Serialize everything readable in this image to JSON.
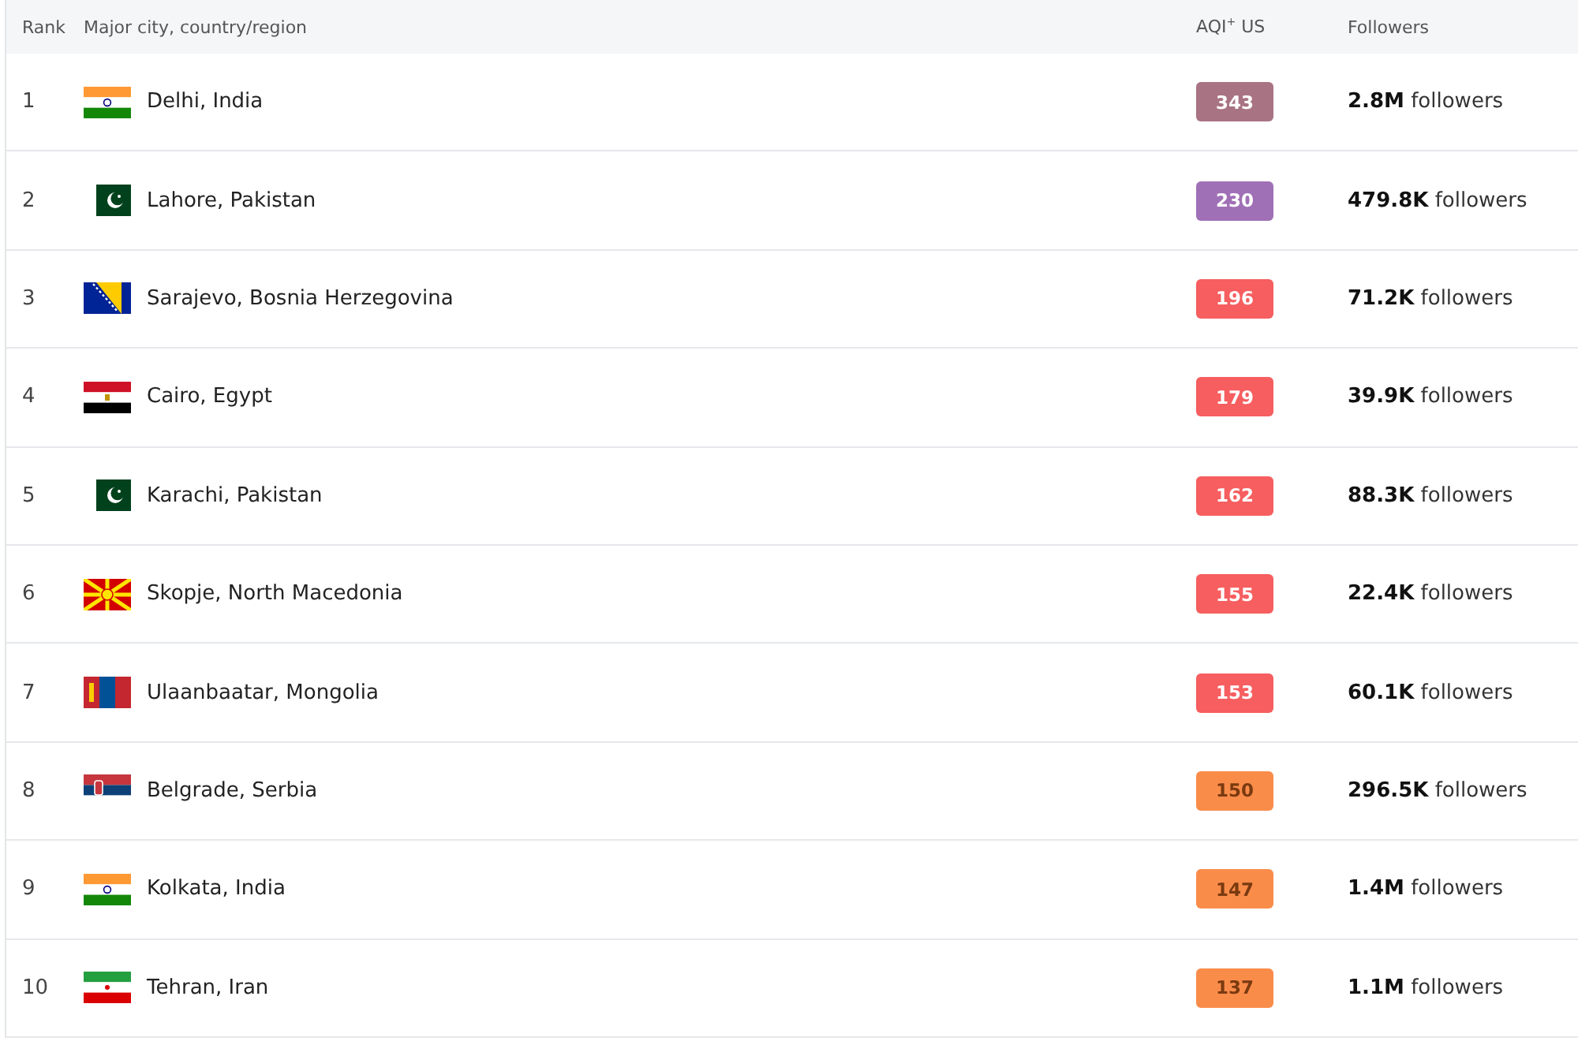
{
  "table": {
    "columns": [
      "Rank",
      "Major city, country/region",
      "AQI$^{+}$ US",
      "Followers"
    ],
    "rows": [
      {
        "rank": "1",
        "kind": "in",
        "city": "Delhi, India",
        "aqi": "343",
        "color": "#a87383",
        "followers": "**2.8M** followers"
      },
      {
        "rank": "2",
        "kind": "pk",
        "city": "Lahore, Pakistan",
        "aqi": "230",
        "color": "#a070b6",
        "followers": "**479.8K** followers"
      },
      {
        "rank": "3",
        "kind": "ba",
        "city": "Sarajevo, Bosnia Herzegovina",
        "aqi": "196",
        "color": "#f65e5f",
        "followers": "**71.2K** followers"
      },
      {
        "rank": "4",
        "kind": "eg",
        "city": "Cairo, Egypt",
        "aqi": "179",
        "color": "#f65e5f",
        "followers": "**39.9K** followers"
      },
      {
        "rank": "5",
        "kind": "pk",
        "city": "Karachi, Pakistan",
        "aqi": "162",
        "color": "#f65e5f",
        "followers": "**88.3K** followers"
      },
      {
        "rank": "6",
        "kind": "mk",
        "city": "Skopje, North Macedonia",
        "aqi": "155",
        "color": "#f65e5f",
        "followers": "**22.4K** followers"
      },
      {
        "rank": "7",
        "kind": "mn",
        "city": "Ulaanbaatar, Mongolia",
        "aqi": "153",
        "color": "#f65e5f",
        "followers": "**60.1K** followers"
      },
      {
        "rank": "8",
        "kind": "rs",
        "city": "Belgrade, Serbia",
        "aqi": "150",
        "color": "#fa8c4a",
        "followers": "**296.5K** followers"
      },
      {
        "rank": "9",
        "kind": "in",
        "city": "Kolkata, India",
        "aqi": "147",
        "color": "#fa8c4a",
        "followers": "**1.4M** followers"
      },
      {
        "rank": "10",
        "kind": "ir",
        "city": "Tehran, Iran",
        "aqi": "137",
        "color": "#fa8c4a",
        "followers": "**1.1M** followers"
      }
    ]
  }
}
